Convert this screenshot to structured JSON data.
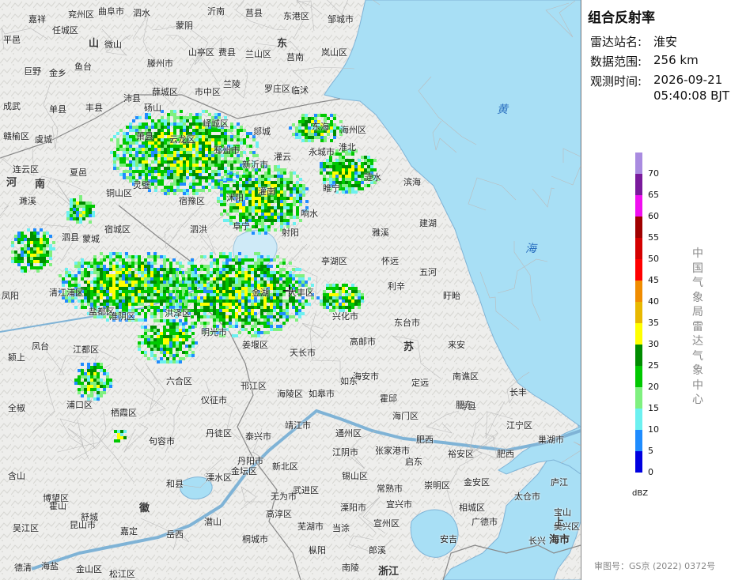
{
  "panel": {
    "title": "组合反射率",
    "station_label": "雷达站名:",
    "station_value": "淮安",
    "range_label": "数据范围:",
    "range_value": "256 km",
    "time_label": "观测时间:",
    "time_date": "2026-09-21",
    "time_clock": "05:40:08 BJT",
    "organization": "中国气象局雷达气象中心",
    "unit": "dBZ",
    "approval": "审图号：GS京 (2022) 0372号"
  },
  "legend": [
    {
      "label": "70",
      "color": "#a98be0"
    },
    {
      "label": "65",
      "color": "#7a1a9c"
    },
    {
      "label": "60",
      "color": "#f00ff0"
    },
    {
      "label": "55",
      "color": "#a00000"
    },
    {
      "label": "50",
      "color": "#d40000"
    },
    {
      "label": "45",
      "color": "#ff0000"
    },
    {
      "label": "40",
      "color": "#f08c00"
    },
    {
      "label": "35",
      "color": "#e8b800"
    },
    {
      "label": "30",
      "color": "#ffff00"
    },
    {
      "label": "25",
      "color": "#008c00"
    },
    {
      "label": "20",
      "color": "#00c800"
    },
    {
      "label": "15",
      "color": "#7ff07f"
    },
    {
      "label": "10",
      "color": "#6cf0f0"
    },
    {
      "label": "5",
      "color": "#1f8cff"
    },
    {
      "label": "0",
      "color": "#0000e0"
    }
  ],
  "map": {
    "sea_color": "#a8dff5",
    "land_color": "#f0f0ee",
    "radar_station": "淮安",
    "provinces": [
      "山",
      "东",
      "河",
      "南",
      "苏",
      "徽",
      "浙江",
      "上",
      "海市"
    ],
    "seas": [
      "黄",
      "海"
    ],
    "places": [
      "嘉祥",
      "任城区",
      "兖州区",
      "曲阜市",
      "泗水",
      "蒙阴",
      "沂南",
      "莒县",
      "东港区",
      "邹城市",
      "平邑",
      "巨野",
      "金乡",
      "鱼台",
      "微山",
      "滕州市",
      "山亭区",
      "费县",
      "兰山区",
      "莒南",
      "岚山区",
      "成武",
      "单县",
      "丰县",
      "沛县",
      "薛城区",
      "市中区",
      "兰陵",
      "罗庄区",
      "临沭",
      "赣榆区",
      "虞城",
      "砀山",
      "峄城区",
      "郯城",
      "东海",
      "海州区",
      "连云区",
      "夏邑",
      "萧县",
      "云龙区",
      "邳州市",
      "新沂市",
      "灌云",
      "永城市",
      "淮北",
      "濉溪",
      "铜山区",
      "宿豫区",
      "沭阳",
      "灌南",
      "响水",
      "睢宁",
      "涟水",
      "滨海",
      "泗县",
      "宿城区",
      "灵璧",
      "泗洪",
      "阜宁",
      "射阳",
      "雅溪",
      "建湖",
      "蒙城",
      "怀远",
      "清江浦区",
      "盐都区",
      "亭湖区",
      "利辛",
      "五河",
      "凤阳",
      "淮阴区",
      "洪泽区",
      "金湖",
      "大丰区",
      "盱眙",
      "明光市",
      "兴化市",
      "颍上",
      "凤台",
      "天长市",
      "高邮市",
      "东台市",
      "来安",
      "江都区",
      "姜堰区",
      "海安市",
      "定远",
      "南谯区",
      "六合区",
      "仪征市",
      "邗江区",
      "海陵区",
      "如皋市",
      "如东",
      "霍邱",
      "寿县",
      "长丰",
      "全椒",
      "浦口区",
      "栖霞区",
      "丹徒区",
      "泰兴市",
      "靖江市",
      "通州区",
      "海门区",
      "肥西",
      "肥东",
      "江宁区",
      "句容市",
      "丹阳市",
      "新北区",
      "江阴市",
      "张家港市",
      "启东",
      "裕安区",
      "肥西",
      "巢湖市",
      "含山",
      "和县",
      "溧水区",
      "金坛区",
      "武进区",
      "锡山区",
      "常熟市",
      "崇明区",
      "金安区",
      "庐江",
      "博望区",
      "高淳区",
      "溧阳市",
      "宜兴市",
      "相城区",
      "太仓市",
      "宝山",
      "霍山",
      "舒城",
      "无为市",
      "芜湖市",
      "当涂",
      "宣州区",
      "广德市",
      "长兴",
      "吴兴区",
      "吴江区",
      "昆山市",
      "嘉定",
      "岳西",
      "潜山",
      "桐城市",
      "枞阳",
      "南陵",
      "郎溪",
      "安吉",
      "德清",
      "海盐",
      "金山区",
      "松江区"
    ]
  }
}
